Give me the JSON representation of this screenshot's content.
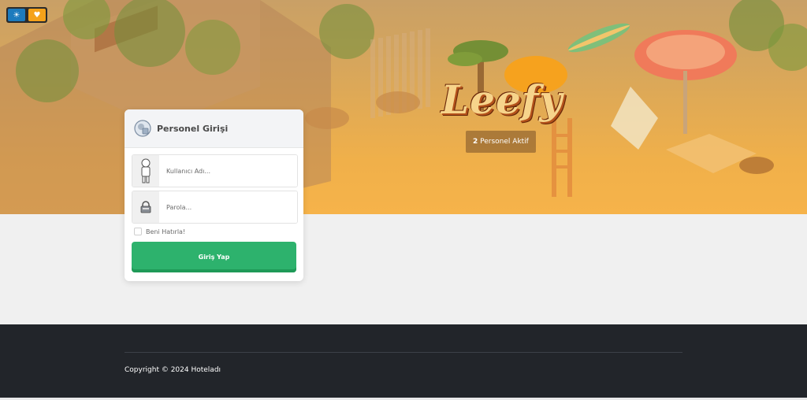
{
  "theme_buttons": {
    "light_icon": "sun-icon",
    "favorite_icon": "heart-icon"
  },
  "hero": {
    "logo_text": "Leefy",
    "staff_online_count": "2",
    "staff_online_label": "Personel Aktif"
  },
  "login": {
    "title": "Personel Girişi",
    "username_placeholder": "Kullanıcı Adı...",
    "password_placeholder": "Parola...",
    "remember_label": "Beni Hatırla!",
    "submit_label": "Giriş Yap"
  },
  "footer": {
    "copyright": "Copyright © 2024 Hoteladı"
  },
  "colors": {
    "accent_green": "#2db26d",
    "theme_blue": "#1d7bbd",
    "theme_orange": "#f5a21a",
    "footer_bg": "#22252a"
  }
}
